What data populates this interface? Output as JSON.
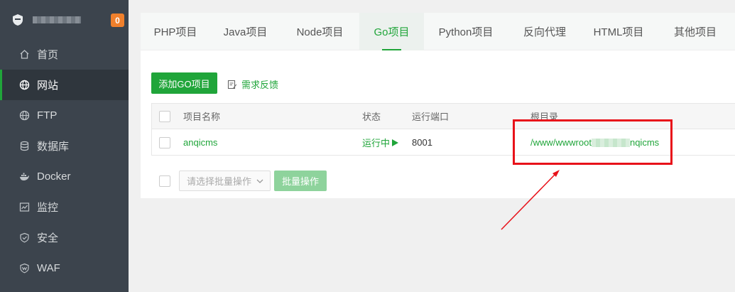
{
  "sidebar": {
    "badge": "0",
    "items": [
      {
        "label": "首页",
        "icon": "home-icon"
      },
      {
        "label": "网站",
        "icon": "globe-icon"
      },
      {
        "label": "FTP",
        "icon": "globe-icon"
      },
      {
        "label": "数据库",
        "icon": "database-icon"
      },
      {
        "label": "Docker",
        "icon": "docker-icon"
      },
      {
        "label": "监控",
        "icon": "monitor-icon"
      },
      {
        "label": "安全",
        "icon": "shield-icon"
      },
      {
        "label": "WAF",
        "icon": "shield-icon"
      }
    ],
    "active_index": 1
  },
  "tabs": [
    "PHP项目",
    "Java项目",
    "Node项目",
    "Go项目",
    "Python项目",
    "反向代理",
    "HTML项目",
    "其他项目"
  ],
  "active_tab": "Go项目",
  "toolbar": {
    "add_label": "添加GO项目",
    "feedback_label": "需求反馈"
  },
  "table": {
    "headers": {
      "name": "项目名称",
      "status": "状态",
      "port": "运行端口",
      "root": "根目录"
    },
    "rows": [
      {
        "name": "anqicms",
        "status": "运行中",
        "port": "8001",
        "root_prefix": "/www/wwwroot",
        "root_suffix": "nqicms"
      }
    ]
  },
  "batch": {
    "placeholder": "请选择批量操作",
    "button": "批量操作"
  },
  "colors": {
    "accent": "#20a53a",
    "sidebar_bg": "#3c444d",
    "badge": "#f0802c",
    "annotation": "#e8121a"
  }
}
